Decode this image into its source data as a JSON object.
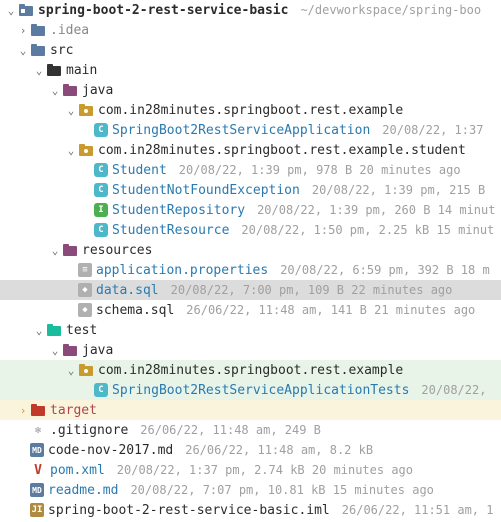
{
  "project": {
    "name": "spring-boot-2-rest-service-basic",
    "path": "~/devworkspace/spring-boo"
  },
  "idea": {
    "name": ".idea"
  },
  "src": {
    "name": "src"
  },
  "main": {
    "name": "main"
  },
  "java": {
    "name": "java"
  },
  "pkg1": {
    "name": "com.in28minutes.springboot.rest.example"
  },
  "app": {
    "name": "SpringBoot2RestServiceApplication",
    "meta": "20/08/22, 1:37"
  },
  "pkg2": {
    "name": "com.in28minutes.springboot.rest.example.student"
  },
  "student": {
    "name": "Student",
    "meta": "20/08/22, 1:39 pm, 978 B 20 minutes ago"
  },
  "snfe": {
    "name": "StudentNotFoundException",
    "meta": "20/08/22, 1:39 pm, 215 B"
  },
  "srepo": {
    "name": "StudentRepository",
    "meta": "20/08/22, 1:39 pm, 260 B 14 minut"
  },
  "sres": {
    "name": "StudentResource",
    "meta": "20/08/22, 1:50 pm, 2.25 kB 15 minut"
  },
  "resources": {
    "name": "resources"
  },
  "appprops": {
    "name": "application.properties",
    "meta": "20/08/22, 6:59 pm, 392 B 18 m"
  },
  "datasql": {
    "name": "data.sql",
    "meta": "20/08/22, 7:00 pm, 109 B 22 minutes ago"
  },
  "schemasql": {
    "name": "schema.sql",
    "meta": "26/06/22, 11:48 am, 141 B 21 minutes ago"
  },
  "test": {
    "name": "test"
  },
  "javat": {
    "name": "java"
  },
  "pkgtest": {
    "name": "com.in28minutes.springboot.rest.example"
  },
  "apptest": {
    "name": "SpringBoot2RestServiceApplicationTests",
    "meta": "20/08/22,"
  },
  "target": {
    "name": "target"
  },
  "gitignore": {
    "name": ".gitignore",
    "meta": "26/06/22, 11:48 am, 249 B"
  },
  "codenov": {
    "name": "code-nov-2017.md",
    "meta": "26/06/22, 11:48 am, 8.2 kB"
  },
  "pom": {
    "name": "pom.xml",
    "meta": "20/08/22, 1:37 pm, 2.74 kB 20 minutes ago"
  },
  "readme": {
    "name": "readme.md",
    "meta": "20/08/22, 7:07 pm, 10.81 kB 15 minutes ago"
  },
  "iml": {
    "name": "spring-boot-2-rest-service-basic.iml",
    "meta": "26/06/22, 11:51 am, 1"
  }
}
